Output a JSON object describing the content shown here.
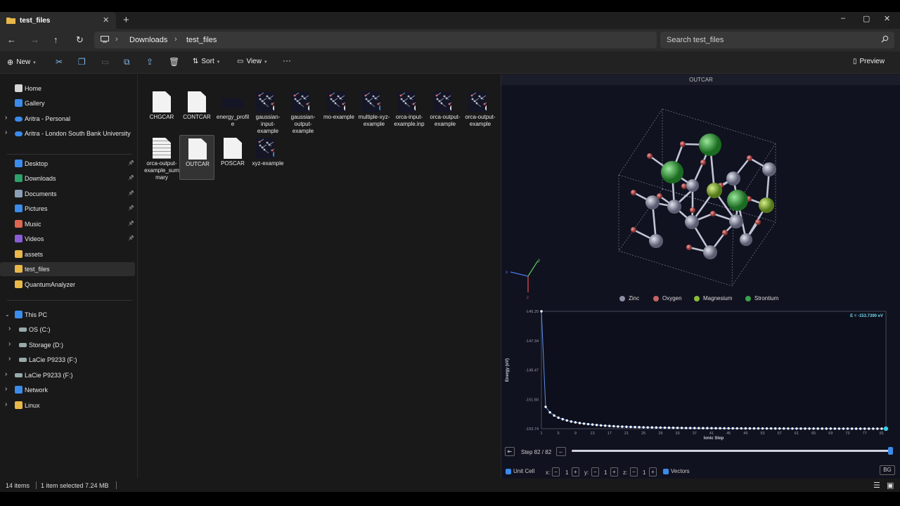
{
  "window": {
    "tab_title": "test_files",
    "controls": [
      "–",
      "▢",
      "✕"
    ]
  },
  "address": {
    "crumbs": [
      "Downloads",
      "test_files"
    ],
    "search_placeholder": "Search test_files"
  },
  "commands": {
    "new": "New",
    "sort": "Sort",
    "view": "View",
    "more": "···",
    "preview": "Preview"
  },
  "sidebar": {
    "items": [
      {
        "label": "Home",
        "icon": "home-icon",
        "color": "#d6d6d6"
      },
      {
        "label": "Gallery",
        "icon": "gallery-icon",
        "color": "#3b8beb"
      },
      {
        "label": "Aritra - Personal",
        "icon": "cloud-icon",
        "color": "#3b8beb"
      },
      {
        "label": "Aritra - London South Bank University",
        "icon": "cloud-icon",
        "color": "#3b8beb"
      },
      {
        "label": "Desktop",
        "icon": "desktop-icon",
        "color": "#3b8beb"
      },
      {
        "label": "Downloads",
        "icon": "download-icon",
        "color": "#2ea06b"
      },
      {
        "label": "Documents",
        "icon": "documents-icon",
        "color": "#8aa0b8"
      },
      {
        "label": "Pictures",
        "icon": "pictures-icon",
        "color": "#3b8beb"
      },
      {
        "label": "Music",
        "icon": "music-icon",
        "color": "#e0654e"
      },
      {
        "label": "Videos",
        "icon": "videos-icon",
        "color": "#8a5cd6"
      },
      {
        "label": "assets",
        "icon": "folder-icon",
        "color": "#e8b84a"
      },
      {
        "label": "test_files",
        "icon": "folder-icon",
        "color": "#e8b84a"
      },
      {
        "label": "QuantumAnalyzer",
        "icon": "folder-icon",
        "color": "#e8b84a"
      },
      {
        "label": "This PC",
        "icon": "pc-icon",
        "color": "#3b8beb"
      },
      {
        "label": "OS (C:)",
        "icon": "drive-icon",
        "color": "#9aa"
      },
      {
        "label": "Storage (D:)",
        "icon": "drive-icon",
        "color": "#9aa"
      },
      {
        "label": "LaCie P9233 (F:)",
        "icon": "drive-icon",
        "color": "#9aa"
      },
      {
        "label": "LaCie P9233 (F:)",
        "icon": "drive-icon",
        "color": "#9aa"
      },
      {
        "label": "Network",
        "icon": "network-icon",
        "color": "#3b8beb"
      },
      {
        "label": "Linux",
        "icon": "linux-icon",
        "color": "#e8b84a"
      }
    ]
  },
  "files": [
    {
      "name": "CHGCAR",
      "kind": "doc"
    },
    {
      "name": "CONTCAR",
      "kind": "doc"
    },
    {
      "name": "energy_profile",
      "kind": "blank"
    },
    {
      "name": "gaussian-input-example",
      "kind": "mol"
    },
    {
      "name": "gaussian-output-example",
      "kind": "mol"
    },
    {
      "name": "mo-example",
      "kind": "mol"
    },
    {
      "name": "multiple-xyz-example",
      "kind": "mol"
    },
    {
      "name": "orca-input-example.inp",
      "kind": "mol"
    },
    {
      "name": "orca-output-example",
      "kind": "mol"
    },
    {
      "name": "orca-output-example",
      "kind": "mol"
    },
    {
      "name": "orca-output-example_summary",
      "kind": "lines"
    },
    {
      "name": "OUTCAR",
      "kind": "doc"
    },
    {
      "name": "POSCAR",
      "kind": "doc"
    },
    {
      "name": "xyz-example",
      "kind": "mol"
    }
  ],
  "preview": {
    "header": "OUTCAR",
    "legend": [
      {
        "name": "Zinc",
        "color": "#8c8fa3"
      },
      {
        "name": "Oxygen",
        "color": "#c46464"
      },
      {
        "name": "Magnesium",
        "color": "#8cbb3c"
      },
      {
        "name": "Strontium",
        "color": "#3aa24a"
      }
    ],
    "axes": {
      "x": "x",
      "y": "y",
      "z": "z"
    },
    "controls": {
      "step_label": "Step 82 / 82",
      "unit_cell": "Unit Cell",
      "x": "x:",
      "y": "y:",
      "z": "z:",
      "xv": "1",
      "yv": "1",
      "zv": "1",
      "vectors": "Vectors",
      "bg": "BG"
    }
  },
  "chart_data": {
    "type": "line",
    "title": "",
    "xlabel": "Ionic Step",
    "ylabel": "Energy (eV)",
    "annotation": "E = -153.7390 eV",
    "xlim": [
      1,
      82
    ],
    "ylim": [
      -153.74,
      -145.2
    ],
    "yticks": [
      "-145.20",
      "-147.34",
      "-149.47",
      "-151.60",
      "-153.74"
    ],
    "xticks": [
      1,
      5,
      9,
      13,
      17,
      21,
      25,
      29,
      33,
      37,
      41,
      45,
      49,
      53,
      57,
      61,
      65,
      69,
      73,
      77,
      81
    ],
    "x": [
      1,
      2,
      3,
      4,
      5,
      6,
      7,
      8,
      9,
      10,
      11,
      12,
      13,
      14,
      15,
      16,
      17,
      18,
      19,
      20,
      21,
      22,
      23,
      24,
      25,
      26,
      27,
      28,
      29,
      30,
      31,
      32,
      33,
      34,
      35,
      36,
      37,
      38,
      39,
      40,
      41,
      42,
      43,
      44,
      45,
      46,
      47,
      48,
      49,
      50,
      51,
      52,
      53,
      54,
      55,
      56,
      57,
      58,
      59,
      60,
      61,
      62,
      63,
      64,
      65,
      66,
      67,
      68,
      69,
      70,
      71,
      72,
      73,
      74,
      75,
      76,
      77,
      78,
      79,
      80,
      81,
      82
    ],
    "y": [
      -145.2,
      -152.15,
      -152.55,
      -152.78,
      -152.94,
      -153.05,
      -153.14,
      -153.22,
      -153.28,
      -153.33,
      -153.37,
      -153.41,
      -153.44,
      -153.47,
      -153.5,
      -153.52,
      -153.54,
      -153.56,
      -153.58,
      -153.59,
      -153.6,
      -153.61,
      -153.62,
      -153.63,
      -153.64,
      -153.645,
      -153.65,
      -153.655,
      -153.66,
      -153.665,
      -153.67,
      -153.675,
      -153.68,
      -153.685,
      -153.69,
      -153.692,
      -153.695,
      -153.698,
      -153.7,
      -153.702,
      -153.704,
      -153.706,
      -153.708,
      -153.71,
      -153.712,
      -153.714,
      -153.716,
      -153.717,
      -153.718,
      -153.719,
      -153.72,
      -153.721,
      -153.722,
      -153.723,
      -153.724,
      -153.725,
      -153.726,
      -153.727,
      -153.728,
      -153.729,
      -153.73,
      -153.731,
      -153.731,
      -153.732,
      -153.732,
      -153.733,
      -153.733,
      -153.734,
      -153.734,
      -153.735,
      -153.735,
      -153.736,
      -153.736,
      -153.737,
      -153.737,
      -153.737,
      -153.738,
      -153.738,
      -153.738,
      -153.739,
      -153.739,
      -153.739
    ]
  },
  "status": {
    "count": "14 items",
    "selected": "1 item selected  7.24 MB"
  }
}
